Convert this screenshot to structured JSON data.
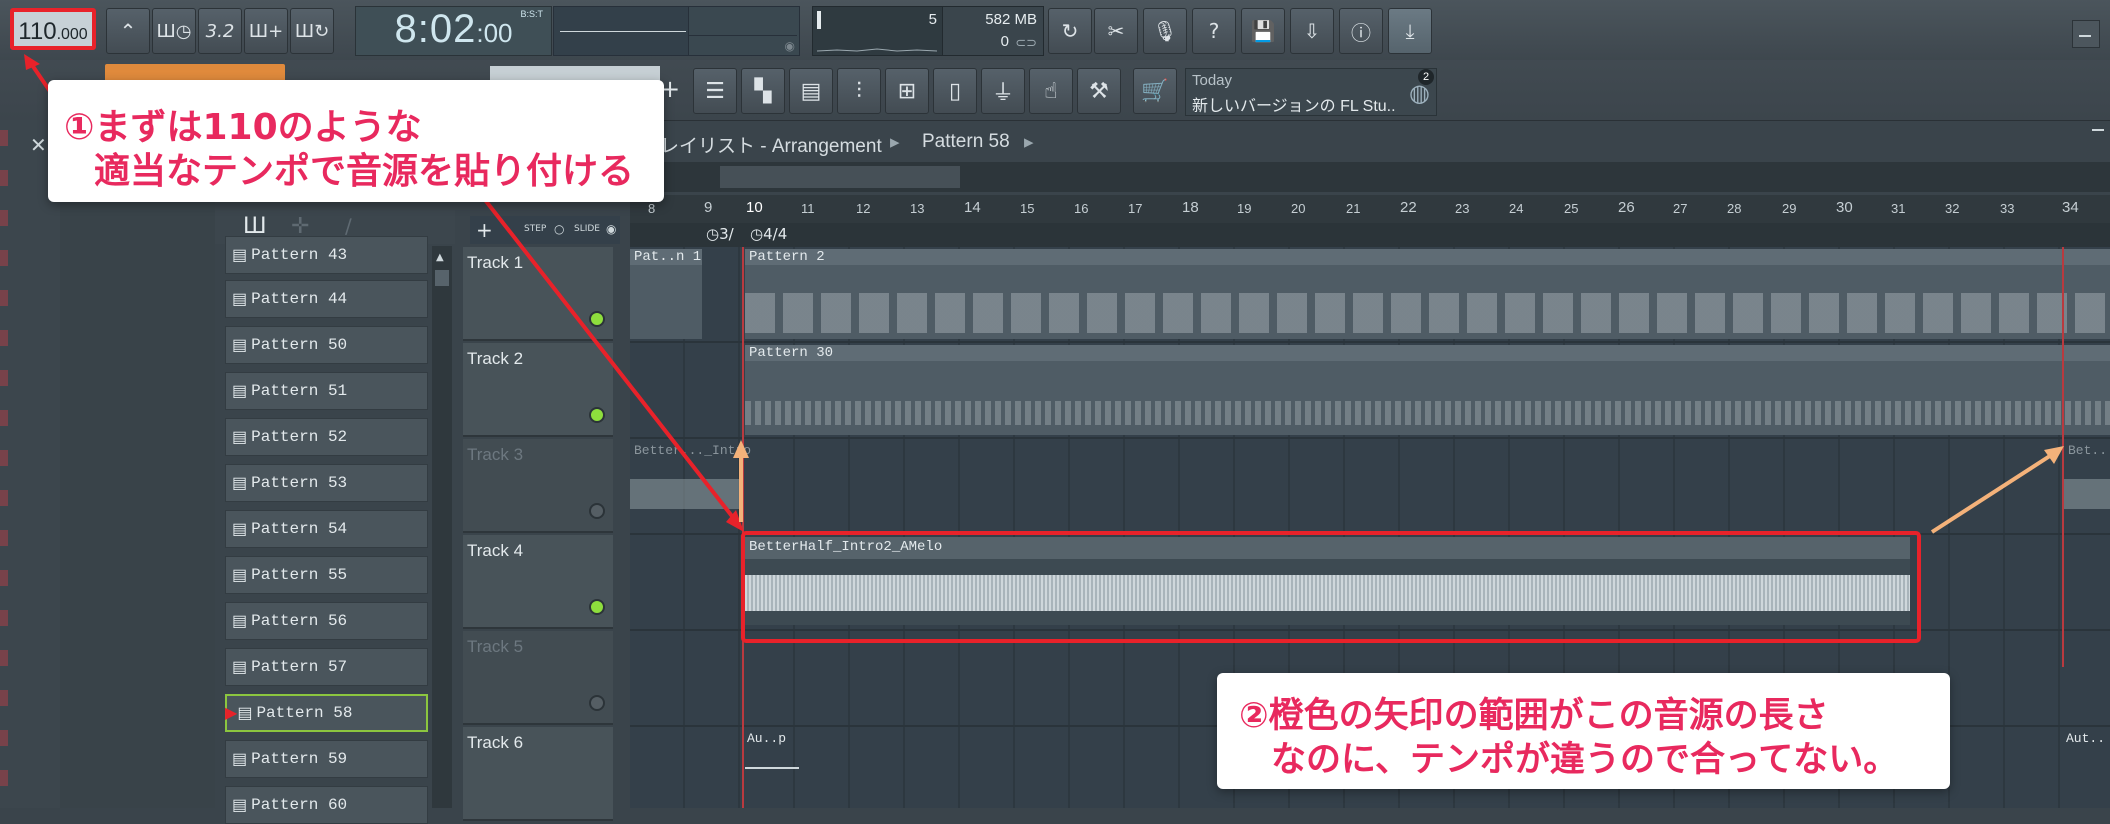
{
  "toolbar": {
    "tempo_main": "110",
    "tempo_dec": ".000",
    "time_main": "8:02",
    "time_sec": ":00",
    "time_bst": "B:S:T",
    "pattern_btn_label": "ш",
    "metro_label": "ш",
    "beat_label": "3.2",
    "add_label": "ш+",
    "loop_label": "ш",
    "cpu_value": "5",
    "mem_value": "582 MB",
    "poly_value": "0"
  },
  "icons": [
    "tempo-icon",
    "metronome-icon",
    "wait-icon",
    "countdown-icon",
    "pattern-add-icon",
    "loop-record-icon",
    "undo-icon",
    "cut-icon",
    "mic-icon",
    "help-icon",
    "save-icon",
    "export-icon",
    "info-icon",
    "download-icon",
    "shop-icon",
    "globe-icon"
  ],
  "hint": {
    "today": "Today",
    "message": "新しいバージョンの FL Stu..",
    "badge": "2"
  },
  "browser": {
    "step_label": "STEP",
    "slide_label": "SLIDE",
    "add_label": "+"
  },
  "patterns": [
    "Pattern 43",
    "Pattern 44",
    "Pattern 50",
    "Pattern 51",
    "Pattern 52",
    "Pattern 53",
    "Pattern 54",
    "Pattern 55",
    "Pattern 56",
    "Pattern 57",
    "Pattern 58",
    "Pattern 59",
    "Pattern 60"
  ],
  "playlist": {
    "title": "レイリスト - Arrangement",
    "current_pattern": "Pattern 58",
    "ruler": [
      "8",
      "9",
      "10",
      "11",
      "12",
      "13",
      "14",
      "15",
      "16",
      "17",
      "18",
      "19",
      "20",
      "21",
      "22",
      "23",
      "24",
      "25",
      "26",
      "27",
      "28",
      "29",
      "30",
      "31",
      "32",
      "33",
      "34"
    ],
    "ts_a": "3/",
    "ts_b": "4/4",
    "tracks": [
      "Track 1",
      "Track 2",
      "Track 3",
      "Track 4",
      "Track 5",
      "Track 6"
    ],
    "clips": {
      "t1a": "Pat..n 1",
      "t1b": "Pattern 2",
      "t2": "Pattern 30",
      "t3a": "Better..._Intro",
      "t3b": "Bet..",
      "t4": "BetterHalf_Intro2_AMelo",
      "t6a": "Au..p",
      "t6b": "Aut.."
    }
  },
  "annotations": {
    "callout1_line1": "①まずは110のような",
    "callout1_line2": "適当なテンポで音源を貼り付ける",
    "callout2_line1": "②橙色の矢印の範囲がこの音源の長さ",
    "callout2_line2": "なのに、テンポが違うので合ってない。",
    "colors": {
      "red": "#e8222a",
      "orange": "#f4b27a",
      "pink_text": "#e8295e"
    }
  }
}
